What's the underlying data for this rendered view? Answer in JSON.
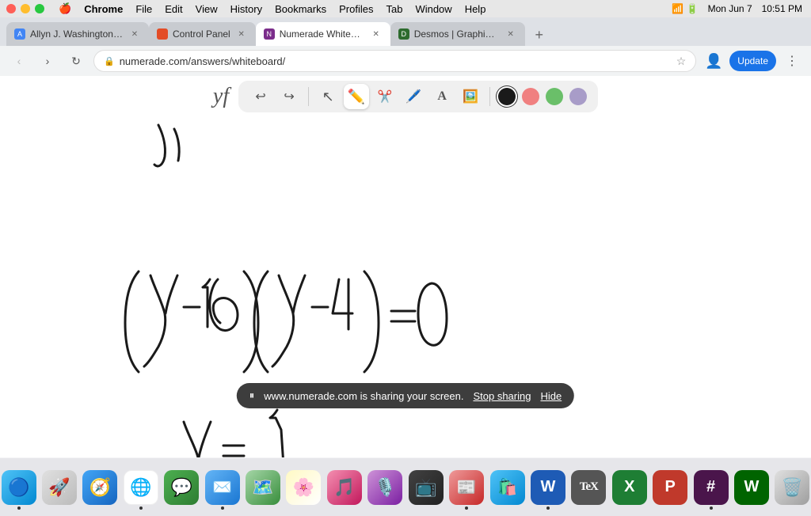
{
  "menubar": {
    "apple": "🍎",
    "items": [
      "Chrome",
      "File",
      "Edit",
      "View",
      "History",
      "Bookmarks",
      "Profiles",
      "Tab",
      "Window",
      "Help"
    ],
    "right": {
      "time": "10:51 PM",
      "date": "Mon Jun 7"
    }
  },
  "tabs": [
    {
      "id": "tab1",
      "title": "Allyn J. Washington, Richard S...",
      "active": false,
      "favicon_color": "#4285f4"
    },
    {
      "id": "tab2",
      "title": "Control Panel",
      "active": false,
      "favicon_color": "#e34c26"
    },
    {
      "id": "tab3",
      "title": "Numerade Whiteboard",
      "active": true,
      "favicon_color": "#7b2d8b"
    },
    {
      "id": "tab4",
      "title": "Desmos | Graphing Calculator",
      "active": false,
      "favicon_color": "#2d6b2e"
    }
  ],
  "addressbar": {
    "url": "numerade.com/answers/whiteboard/",
    "back_disabled": false,
    "forward_disabled": false,
    "update_label": "Update"
  },
  "toolbar": {
    "tools": [
      {
        "id": "undo",
        "icon": "↩",
        "label": "undo"
      },
      {
        "id": "redo",
        "icon": "↪",
        "label": "redo"
      },
      {
        "id": "select",
        "icon": "↖",
        "label": "select"
      },
      {
        "id": "pen",
        "icon": "✏",
        "label": "pen",
        "active": true
      },
      {
        "id": "eraser",
        "icon": "✂",
        "label": "eraser"
      },
      {
        "id": "brush",
        "icon": "🖊",
        "label": "brush"
      },
      {
        "id": "text",
        "icon": "A",
        "label": "text"
      },
      {
        "id": "image",
        "icon": "🖼",
        "label": "image"
      }
    ],
    "colors": [
      {
        "id": "black",
        "hex": "#1a1a1a",
        "selected": true
      },
      {
        "id": "pink",
        "hex": "#f08080"
      },
      {
        "id": "green",
        "hex": "#6abf69"
      },
      {
        "id": "lavender",
        "hex": "#a89cc8"
      }
    ]
  },
  "screen_share": {
    "icon": "⏸",
    "message": "www.numerade.com is sharing your screen.",
    "stop_label": "Stop sharing",
    "hide_label": "Hide"
  },
  "dock_items": [
    {
      "id": "finder",
      "icon": "🔵",
      "color": "#1e88e5",
      "label": "Finder",
      "active": true
    },
    {
      "id": "launchpad",
      "icon": "🚀",
      "color": "#e53935",
      "label": "Launchpad",
      "active": false
    },
    {
      "id": "safari",
      "icon": "🧭",
      "color": "#1565c0",
      "label": "Safari",
      "active": false
    },
    {
      "id": "chrome",
      "icon": "🔴",
      "color": "#4285f4",
      "label": "Chrome",
      "active": true
    },
    {
      "id": "messages",
      "icon": "💬",
      "color": "#43a047",
      "label": "Messages",
      "active": false
    },
    {
      "id": "mail",
      "icon": "✉",
      "color": "#1e88e5",
      "label": "Mail",
      "active": false
    },
    {
      "id": "maps",
      "icon": "🗺",
      "color": "#e53935",
      "label": "Maps",
      "active": false
    },
    {
      "id": "photos",
      "icon": "📷",
      "color": "#f4511e",
      "label": "Photos",
      "active": false
    },
    {
      "id": "music",
      "icon": "🎵",
      "color": "#e91e63",
      "label": "Music",
      "active": false
    },
    {
      "id": "podcasts",
      "icon": "🎙",
      "color": "#8e24aa",
      "label": "Podcasts",
      "active": false
    },
    {
      "id": "tv",
      "icon": "📺",
      "color": "#333",
      "label": "TV",
      "active": false
    },
    {
      "id": "news",
      "icon": "📰",
      "color": "#e53935",
      "label": "News",
      "active": false
    },
    {
      "id": "appstore",
      "icon": "🛍",
      "color": "#1e88e5",
      "label": "App Store",
      "active": false
    },
    {
      "id": "word",
      "icon": "W",
      "color": "#1e5bb5",
      "label": "Word",
      "active": false
    },
    {
      "id": "tex",
      "icon": "T",
      "color": "#4a4a4a",
      "label": "TeX",
      "active": false
    },
    {
      "id": "excel",
      "icon": "X",
      "color": "#1e7e34",
      "label": "Excel",
      "active": false
    },
    {
      "id": "powerpoint",
      "icon": "P",
      "color": "#c0392b",
      "label": "PowerPoint",
      "active": false
    },
    {
      "id": "slack",
      "icon": "#",
      "color": "#4a154b",
      "label": "Slack",
      "active": false
    },
    {
      "id": "webex",
      "icon": "W",
      "color": "#006400",
      "label": "Webex",
      "active": false
    },
    {
      "id": "trash",
      "icon": "🗑",
      "color": "#9e9e9e",
      "label": "Trash",
      "active": false
    }
  ]
}
